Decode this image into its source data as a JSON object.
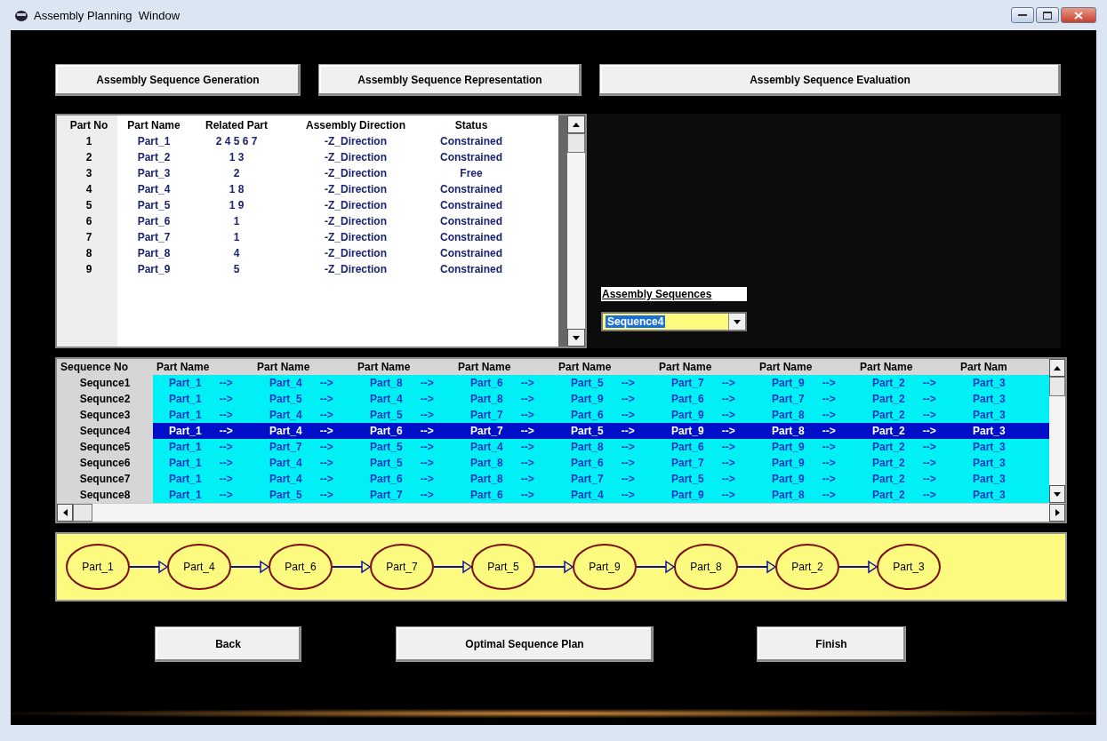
{
  "window": {
    "title": "Assembly Planning  Window"
  },
  "top_buttons": [
    "Assembly Sequence Generation",
    "Assembly Sequence Representation",
    "Assembly Sequence Evaluation"
  ],
  "parts_table": {
    "columns": [
      "Part No",
      "Part Name",
      "Related Part",
      "Assembly Direction",
      "Status"
    ],
    "rows": [
      [
        "1",
        "Part_1",
        "2 4 5 6 7",
        "-Z_Direction",
        "Constrained"
      ],
      [
        "2",
        "Part_2",
        "1 3",
        "-Z_Direction",
        "Constrained"
      ],
      [
        "3",
        "Part_3",
        "2",
        "-Z_Direction",
        "Free"
      ],
      [
        "4",
        "Part_4",
        "1 8",
        "-Z_Direction",
        "Constrained"
      ],
      [
        "5",
        "Part_5",
        "1 9",
        "-Z_Direction",
        "Constrained"
      ],
      [
        "6",
        "Part_6",
        "1",
        "-Z_Direction",
        "Constrained"
      ],
      [
        "7",
        "Part_7",
        "1",
        "-Z_Direction",
        "Constrained"
      ],
      [
        "8",
        "Part_8",
        "4",
        "-Z_Direction",
        "Constrained"
      ],
      [
        "9",
        "Part_9",
        "5",
        "-Z_Direction",
        "Constrained"
      ]
    ]
  },
  "sequence_picker": {
    "label": "Assembly Sequences",
    "value": "Sequence4"
  },
  "sequence_table": {
    "columns": [
      "Sequence No",
      "Part Name",
      "Part Name",
      "Part Name",
      "Part Name",
      "Part Name",
      "Part Name",
      "Part Name",
      "Part Name",
      "Part Nam"
    ],
    "rows": [
      {
        "selected": false,
        "cells": [
          "Sequnce1",
          "Part_1      -->",
          "Part_4      -->",
          "Part_8      -->",
          "Part_6      -->",
          "Part_5      -->",
          "Part_7      -->",
          "Part_9      -->",
          "Part_2      -->",
          "Part_3"
        ]
      },
      {
        "selected": false,
        "cells": [
          "Sequnce2",
          "Part_1      -->",
          "Part_5      -->",
          "Part_4      -->",
          "Part_8      -->",
          "Part_9      -->",
          "Part_6      -->",
          "Part_7      -->",
          "Part_2      -->",
          "Part_3"
        ]
      },
      {
        "selected": false,
        "cells": [
          "Sequnce3",
          "Part_1      -->",
          "Part_4      -->",
          "Part_5      -->",
          "Part_7      -->",
          "Part_6      -->",
          "Part_9      -->",
          "Part_8      -->",
          "Part_2      -->",
          "Part_3"
        ]
      },
      {
        "selected": true,
        "cells": [
          "Sequnce4",
          "Part_1      -->",
          "Part_4      -->",
          "Part_6      -->",
          "Part_7      -->",
          "Part_5      -->",
          "Part_9      -->",
          "Part_8      -->",
          "Part_2      -->",
          "Part_3"
        ]
      },
      {
        "selected": false,
        "cells": [
          "Sequnce5",
          "Part_1      -->",
          "Part_7      -->",
          "Part_5      -->",
          "Part_4      -->",
          "Part_8      -->",
          "Part_6      -->",
          "Part_9      -->",
          "Part_2      -->",
          "Part_3"
        ]
      },
      {
        "selected": false,
        "cells": [
          "Sequnce6",
          "Part_1      -->",
          "Part_4      -->",
          "Part_5      -->",
          "Part_8      -->",
          "Part_6      -->",
          "Part_7      -->",
          "Part_9      -->",
          "Part_2      -->",
          "Part_3"
        ]
      },
      {
        "selected": false,
        "cells": [
          "Sequnce7",
          "Part_1      -->",
          "Part_4      -->",
          "Part_6      -->",
          "Part_8      -->",
          "Part_7      -->",
          "Part_5      -->",
          "Part_9      -->",
          "Part_2      -->",
          "Part_3"
        ]
      },
      {
        "selected": false,
        "cells": [
          "Sequnce8",
          "Part_1      -->",
          "Part_5      -->",
          "Part_7      -->",
          "Part_6      -->",
          "Part_4      -->",
          "Part_9      -->",
          "Part_8      -->",
          "Part_2      -->",
          "Part_3"
        ]
      }
    ]
  },
  "sequence_diagram": {
    "nodes": [
      "Part_1",
      "Part_4",
      "Part_6",
      "Part_7",
      "Part_5",
      "Part_9",
      "Part_8",
      "Part_2",
      "Part_3"
    ]
  },
  "bottom_buttons": [
    "Back",
    "Optimal Sequence Plan",
    "Finish"
  ]
}
